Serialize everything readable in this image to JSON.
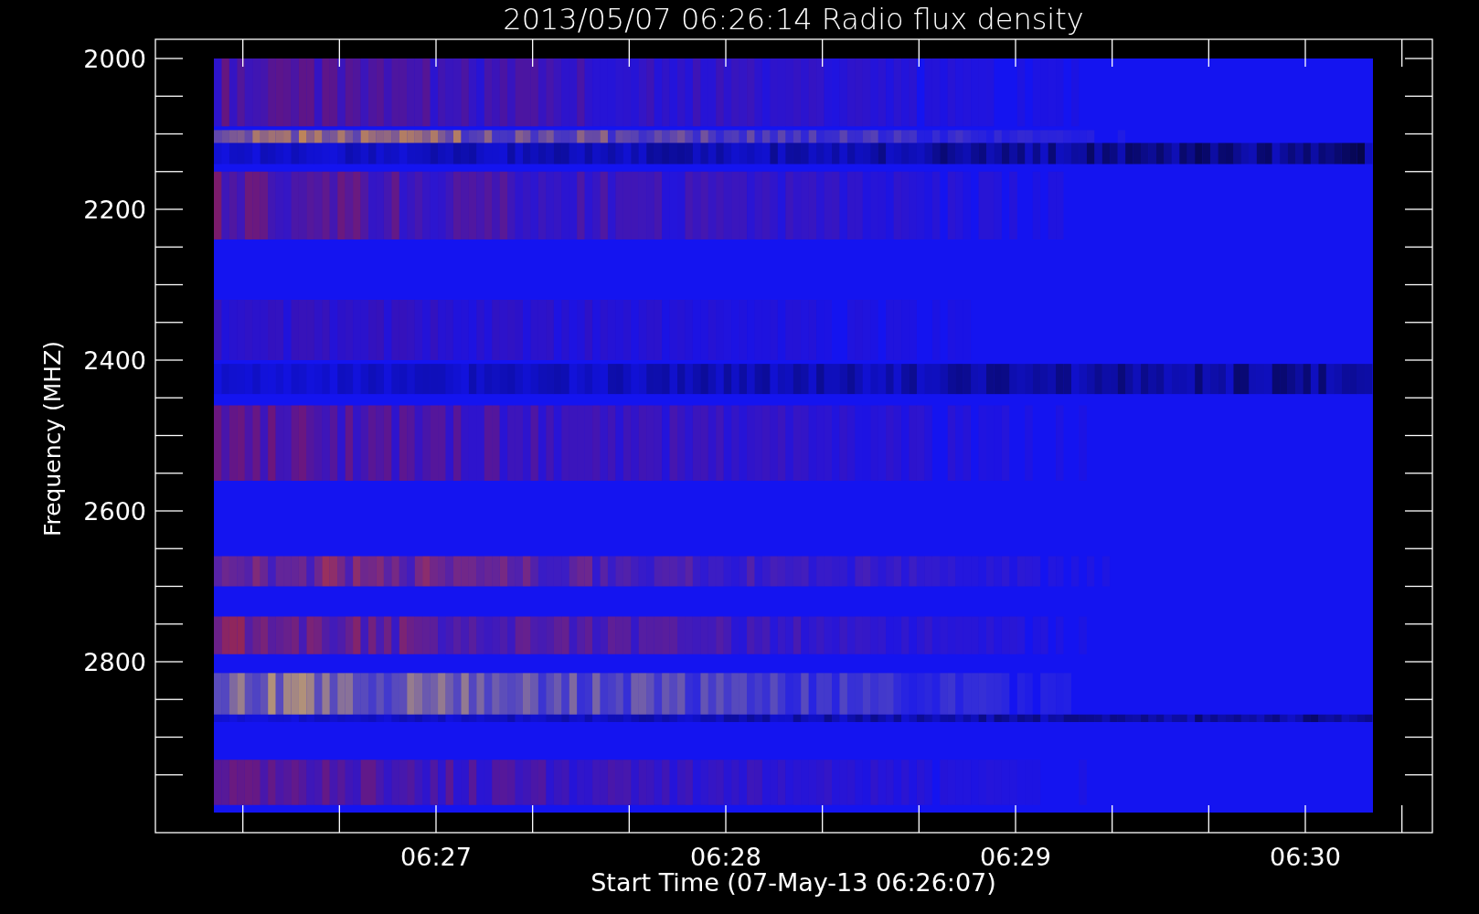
{
  "title": "2013/05/07 06:26:14 Radio flux density",
  "y_axis": {
    "label": "Frequency (MHZ)",
    "ticks": [
      "2000",
      "2200",
      "2400",
      "2600",
      "2800"
    ]
  },
  "x_axis": {
    "label": "Start Time (07-May-13 06:26:07)",
    "ticks": [
      "06:27",
      "06:28",
      "06:29",
      "06:30"
    ]
  }
}
